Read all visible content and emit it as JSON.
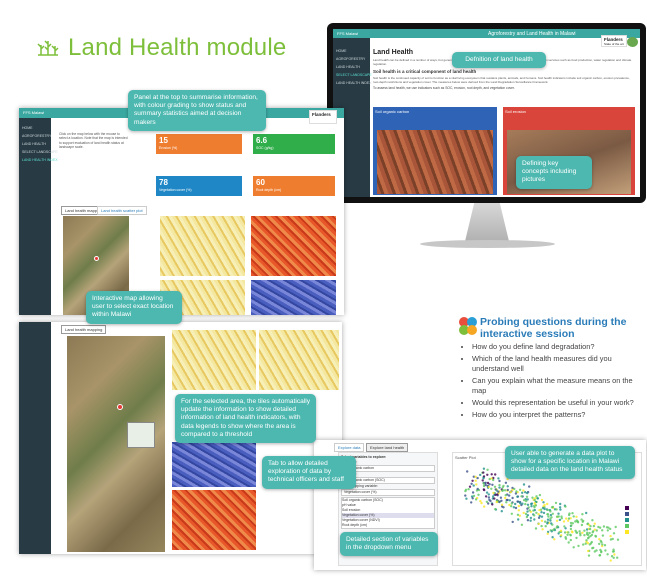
{
  "title": "Land Health module",
  "monitor": {
    "topbar_left": "FFS Malawi",
    "topbar_title": "Agroforestry and Land Health in Malawi",
    "brand": "Flanders",
    "brand_sub": "State of the art",
    "sidebar": [
      "HOME",
      "AGROFORESTRY",
      "LAND HEALTH",
      "SELECT LANDSCAPE",
      "LAND HEALTH INDEX"
    ],
    "heading": "Land Health",
    "intro": "Land health can be defined in a number of ways, but generally refers to the capacity of the land to sustain the delivery of ecosystem services such as food production, water regulation and climate regulation.",
    "subheading": "Soil health is a critical component of land health",
    "body": "Soil health is the continued capacity of soil to function as a vital living ecosystem that sustains plants, animals, and humans. Soil health indicators include soil organic carbon, erosion prevalence, root-depth restrictions and vegetation cover. The measures below were derived from the Land Degradation Surveillance Framework.",
    "note": "To assess land health, we use indicators such as SOC, erosion, root depth, and vegetation cover.",
    "card1_title": "Soil organic carbon",
    "card2_title": "Soil erosion"
  },
  "callouts": {
    "definition": "Defnition of land health",
    "panel_top": "Panel at the top to summarise information, with colour grading to show status and summary statistics aimed at decision makers",
    "key_concepts": "Defining key concepts including pictures",
    "interactive_map": "Interactive map allowing user to select exact location within Malawi",
    "tiles": "For the selected area, the tiles automatically update the information to show detailed information of land health indicators, with data legends to show where the area is compared to a threshold",
    "tab": "Tab to allow detailed exploration of data by technical officers and staff",
    "datapoint": "User able to generate a data plot to show for a specific location in Malawi detailed data on the land health status",
    "dropdown": "Detailed section of variables in the dropdown menu"
  },
  "dashboard": {
    "topbar_left": "FFS Malawi",
    "brand": "Flanders",
    "sidebar": [
      "HOME",
      "AGROFORESTRY",
      "LAND HEALTH",
      "SELECT LANDSCAPE",
      "LAND HEALTH INDEX"
    ],
    "intro": "Click on the map below with the mouse to select a location. Note that the map is intended to support evaluation of land health status at landscape scale.",
    "stats": [
      {
        "value": "15",
        "label": "Erosion (%)",
        "color": "#ef7d2f"
      },
      {
        "value": "6.6",
        "label": "SOC (g/kg)",
        "color": "#2fae4a"
      },
      {
        "value": "78",
        "label": "Vegetation cover (%)",
        "color": "#1f87c6"
      },
      {
        "value": "60",
        "label": "Root depth (cm)",
        "color": "#ef7d2f"
      }
    ],
    "tab_active": "Land health mapping",
    "tab_other": "Land health scatter plot"
  },
  "scatter_panel": {
    "tab_active": "Explore data",
    "tab_other": "Explore land health",
    "select_label": "Select variables to explore:",
    "x_label": "X variable",
    "x_value": "Soil organic carbon",
    "y_label": "Y variable",
    "y_value": "Soil organic carbon (SOC)",
    "color_label": "Color mapping variable:",
    "color_value": "Vegetation cover (%)",
    "options": [
      "Soil organic carbon (SOC)",
      "pH value",
      "Soil erosion",
      "Vegetation cover (%)",
      "Vegetation cover (NDVI)",
      "Root depth (cm)"
    ],
    "plot_title": "Scatter Plot"
  },
  "questions": {
    "title": "Probing questions during the interactive session",
    "items": [
      "How do you define land degradation?",
      "Which of the land health measures did you understand well",
      "Can you explain what the measure means on the map",
      "Would this representation be useful in your work?",
      "How do you interpret the patterns?"
    ]
  },
  "colors": {
    "accent": "#4db8b0",
    "title_green": "#7dbf3a",
    "question_blue": "#2a7cb8"
  }
}
